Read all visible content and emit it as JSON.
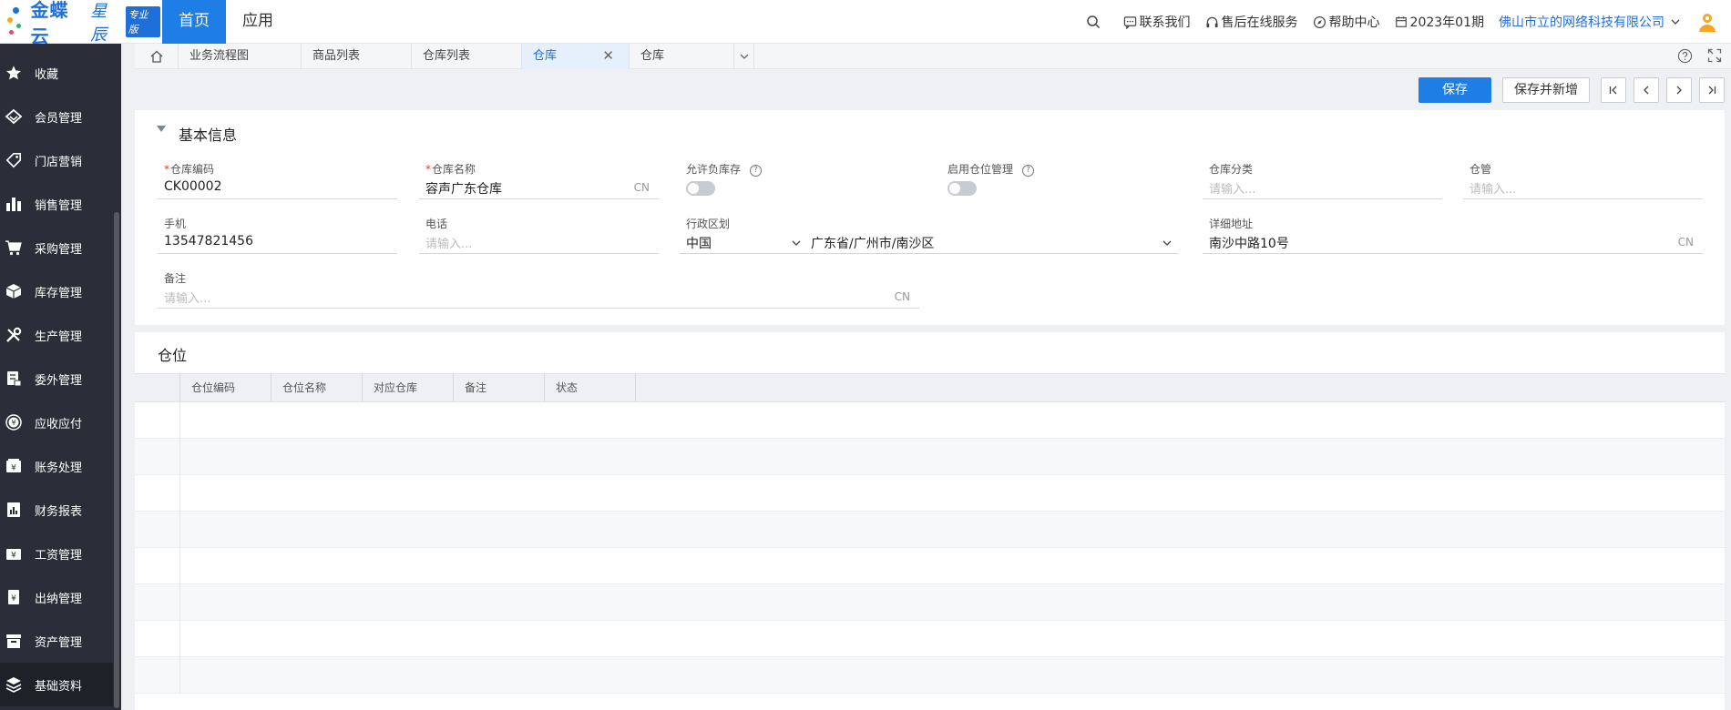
{
  "brand": {
    "name": "金蝶云",
    "product": "星辰",
    "edition": "专业版",
    "colors": {
      "primary": "#1e7ee6",
      "sidebar": "#2b2e38"
    }
  },
  "topnav": {
    "home": "首页",
    "apps": "应用",
    "contact": "联系我们",
    "service": "售后在线服务",
    "help": "帮助中心",
    "period": "2023年01期",
    "company": "佛山市立的网络科技有限公司"
  },
  "sidebar": {
    "items": [
      {
        "label": "收藏",
        "icon": "star-icon"
      },
      {
        "label": "会员管理",
        "icon": "diamond-icon"
      },
      {
        "label": "门店营销",
        "icon": "tag-icon"
      },
      {
        "label": "销售管理",
        "icon": "bar-chart-icon"
      },
      {
        "label": "采购管理",
        "icon": "cart-icon"
      },
      {
        "label": "库存管理",
        "icon": "box-icon"
      },
      {
        "label": "生产管理",
        "icon": "tools-icon"
      },
      {
        "label": "委外管理",
        "icon": "outsource-icon"
      },
      {
        "label": "应收应付",
        "icon": "yen-circle-icon"
      },
      {
        "label": "账务处理",
        "icon": "ledger-icon"
      },
      {
        "label": "财务报表",
        "icon": "report-icon"
      },
      {
        "label": "工资管理",
        "icon": "salary-icon"
      },
      {
        "label": "出纳管理",
        "icon": "cashier-icon"
      },
      {
        "label": "资产管理",
        "icon": "asset-icon"
      },
      {
        "label": "基础资料",
        "icon": "layers-icon"
      }
    ]
  },
  "tabs": [
    {
      "label": "业务流程图"
    },
    {
      "label": "商品列表"
    },
    {
      "label": "仓库列表"
    },
    {
      "label": "仓库",
      "active": true
    },
    {
      "label": "仓库"
    }
  ],
  "toolbar": {
    "save": "保存",
    "save_new": "保存并新增"
  },
  "basic": {
    "title": "基本信息",
    "code": {
      "label": "仓库编码",
      "value": "CK00002"
    },
    "name": {
      "label": "仓库名称",
      "value": "容声广东仓库",
      "suffix": "CN"
    },
    "allow_negative": {
      "label": "允许负库存",
      "value": "off"
    },
    "enable_location": {
      "label": "启用仓位管理",
      "value": "off"
    },
    "category": {
      "label": "仓库分类",
      "placeholder": "请输入..."
    },
    "keeper": {
      "label": "仓管",
      "placeholder": "请输入..."
    },
    "mobile": {
      "label": "手机",
      "value": "13547821456"
    },
    "phone": {
      "label": "电话",
      "placeholder": "请输入..."
    },
    "region": {
      "label": "行政区划",
      "country": "中国",
      "province": "广东省/广州市/南沙区"
    },
    "address": {
      "label": "详细地址",
      "value": "南沙中路10号",
      "suffix": "CN"
    },
    "remark": {
      "label": "备注",
      "placeholder": "请输入...",
      "suffix": "CN"
    }
  },
  "location": {
    "title": "仓位",
    "columns": [
      "仓位编码",
      "仓位名称",
      "对应仓库",
      "备注",
      "状态"
    ]
  }
}
